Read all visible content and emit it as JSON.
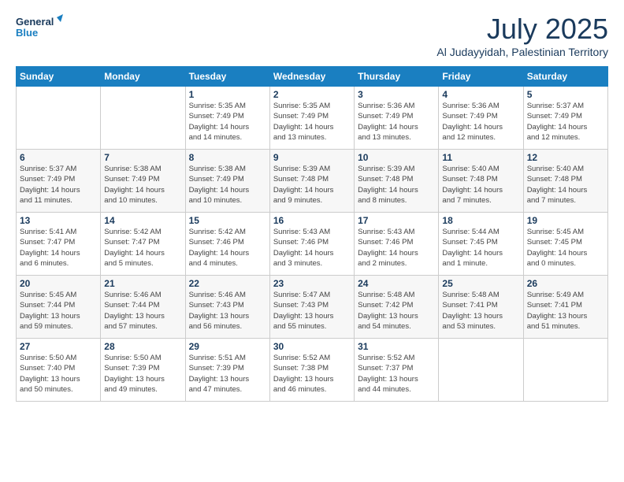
{
  "logo": {
    "line1": "General",
    "line2": "Blue"
  },
  "title": "July 2025",
  "subtitle": "Al Judayyidah, Palestinian Territory",
  "days_header": [
    "Sunday",
    "Monday",
    "Tuesday",
    "Wednesday",
    "Thursday",
    "Friday",
    "Saturday"
  ],
  "weeks": [
    [
      {
        "day": "",
        "text": ""
      },
      {
        "day": "",
        "text": ""
      },
      {
        "day": "1",
        "text": "Sunrise: 5:35 AM\nSunset: 7:49 PM\nDaylight: 14 hours\nand 14 minutes."
      },
      {
        "day": "2",
        "text": "Sunrise: 5:35 AM\nSunset: 7:49 PM\nDaylight: 14 hours\nand 13 minutes."
      },
      {
        "day": "3",
        "text": "Sunrise: 5:36 AM\nSunset: 7:49 PM\nDaylight: 14 hours\nand 13 minutes."
      },
      {
        "day": "4",
        "text": "Sunrise: 5:36 AM\nSunset: 7:49 PM\nDaylight: 14 hours\nand 12 minutes."
      },
      {
        "day": "5",
        "text": "Sunrise: 5:37 AM\nSunset: 7:49 PM\nDaylight: 14 hours\nand 12 minutes."
      }
    ],
    [
      {
        "day": "6",
        "text": "Sunrise: 5:37 AM\nSunset: 7:49 PM\nDaylight: 14 hours\nand 11 minutes."
      },
      {
        "day": "7",
        "text": "Sunrise: 5:38 AM\nSunset: 7:49 PM\nDaylight: 14 hours\nand 10 minutes."
      },
      {
        "day": "8",
        "text": "Sunrise: 5:38 AM\nSunset: 7:49 PM\nDaylight: 14 hours\nand 10 minutes."
      },
      {
        "day": "9",
        "text": "Sunrise: 5:39 AM\nSunset: 7:48 PM\nDaylight: 14 hours\nand 9 minutes."
      },
      {
        "day": "10",
        "text": "Sunrise: 5:39 AM\nSunset: 7:48 PM\nDaylight: 14 hours\nand 8 minutes."
      },
      {
        "day": "11",
        "text": "Sunrise: 5:40 AM\nSunset: 7:48 PM\nDaylight: 14 hours\nand 7 minutes."
      },
      {
        "day": "12",
        "text": "Sunrise: 5:40 AM\nSunset: 7:48 PM\nDaylight: 14 hours\nand 7 minutes."
      }
    ],
    [
      {
        "day": "13",
        "text": "Sunrise: 5:41 AM\nSunset: 7:47 PM\nDaylight: 14 hours\nand 6 minutes."
      },
      {
        "day": "14",
        "text": "Sunrise: 5:42 AM\nSunset: 7:47 PM\nDaylight: 14 hours\nand 5 minutes."
      },
      {
        "day": "15",
        "text": "Sunrise: 5:42 AM\nSunset: 7:46 PM\nDaylight: 14 hours\nand 4 minutes."
      },
      {
        "day": "16",
        "text": "Sunrise: 5:43 AM\nSunset: 7:46 PM\nDaylight: 14 hours\nand 3 minutes."
      },
      {
        "day": "17",
        "text": "Sunrise: 5:43 AM\nSunset: 7:46 PM\nDaylight: 14 hours\nand 2 minutes."
      },
      {
        "day": "18",
        "text": "Sunrise: 5:44 AM\nSunset: 7:45 PM\nDaylight: 14 hours\nand 1 minute."
      },
      {
        "day": "19",
        "text": "Sunrise: 5:45 AM\nSunset: 7:45 PM\nDaylight: 14 hours\nand 0 minutes."
      }
    ],
    [
      {
        "day": "20",
        "text": "Sunrise: 5:45 AM\nSunset: 7:44 PM\nDaylight: 13 hours\nand 59 minutes."
      },
      {
        "day": "21",
        "text": "Sunrise: 5:46 AM\nSunset: 7:44 PM\nDaylight: 13 hours\nand 57 minutes."
      },
      {
        "day": "22",
        "text": "Sunrise: 5:46 AM\nSunset: 7:43 PM\nDaylight: 13 hours\nand 56 minutes."
      },
      {
        "day": "23",
        "text": "Sunrise: 5:47 AM\nSunset: 7:43 PM\nDaylight: 13 hours\nand 55 minutes."
      },
      {
        "day": "24",
        "text": "Sunrise: 5:48 AM\nSunset: 7:42 PM\nDaylight: 13 hours\nand 54 minutes."
      },
      {
        "day": "25",
        "text": "Sunrise: 5:48 AM\nSunset: 7:41 PM\nDaylight: 13 hours\nand 53 minutes."
      },
      {
        "day": "26",
        "text": "Sunrise: 5:49 AM\nSunset: 7:41 PM\nDaylight: 13 hours\nand 51 minutes."
      }
    ],
    [
      {
        "day": "27",
        "text": "Sunrise: 5:50 AM\nSunset: 7:40 PM\nDaylight: 13 hours\nand 50 minutes."
      },
      {
        "day": "28",
        "text": "Sunrise: 5:50 AM\nSunset: 7:39 PM\nDaylight: 13 hours\nand 49 minutes."
      },
      {
        "day": "29",
        "text": "Sunrise: 5:51 AM\nSunset: 7:39 PM\nDaylight: 13 hours\nand 47 minutes."
      },
      {
        "day": "30",
        "text": "Sunrise: 5:52 AM\nSunset: 7:38 PM\nDaylight: 13 hours\nand 46 minutes."
      },
      {
        "day": "31",
        "text": "Sunrise: 5:52 AM\nSunset: 7:37 PM\nDaylight: 13 hours\nand 44 minutes."
      },
      {
        "day": "",
        "text": ""
      },
      {
        "day": "",
        "text": ""
      }
    ]
  ]
}
